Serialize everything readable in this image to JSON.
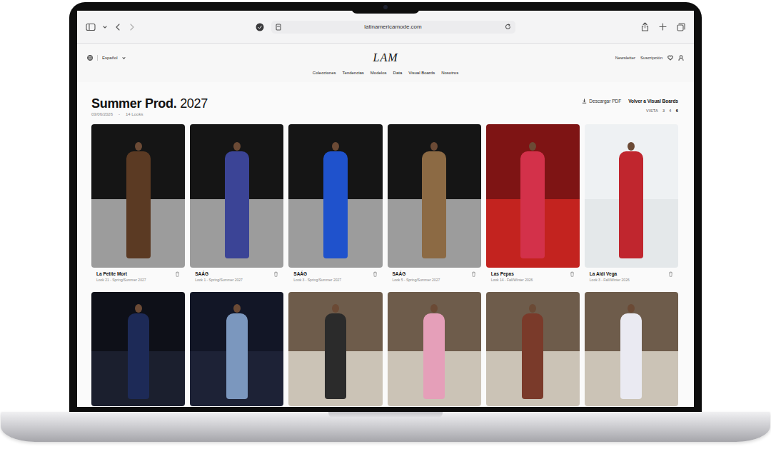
{
  "browser": {
    "url": "latinamericamode.com"
  },
  "header": {
    "language": "Español",
    "logo": "LAM",
    "links": [
      "Newsletter",
      "Suscripción"
    ]
  },
  "nav": [
    "Colecciones",
    "Tendencias",
    "Modelos",
    "Data",
    "Visual Boards",
    "Nosotros"
  ],
  "board": {
    "title": "Summer Prod.",
    "year": "2027",
    "date": "03/06/2026",
    "separator": "-",
    "count": "14 Looks",
    "download": "Descargar PDF",
    "back": "Volver a Visual Boards",
    "view_label": "VISTA",
    "view_options": [
      {
        "label": "3",
        "selected": false
      },
      {
        "label": "4",
        "selected": false
      },
      {
        "label": "6",
        "selected": true
      }
    ]
  },
  "looks": [
    {
      "brand": "La Petite Mort",
      "caption": "Look 21 - Spring/Summer 2027"
    },
    {
      "brand": "SAÁG",
      "caption": "Look 1 - Spring/Summer 2027"
    },
    {
      "brand": "SAÁG",
      "caption": "Look 3 - Spring/Summer 2027"
    },
    {
      "brand": "SAÁG",
      "caption": "Look 5 - Spring/Summer 2027"
    },
    {
      "brand": "Las Pepas",
      "caption": "Look 14 - Fall/Winter 2026"
    },
    {
      "brand": "La Aldi Vega",
      "caption": "Look 3 - Fall/Winter 2026"
    }
  ]
}
